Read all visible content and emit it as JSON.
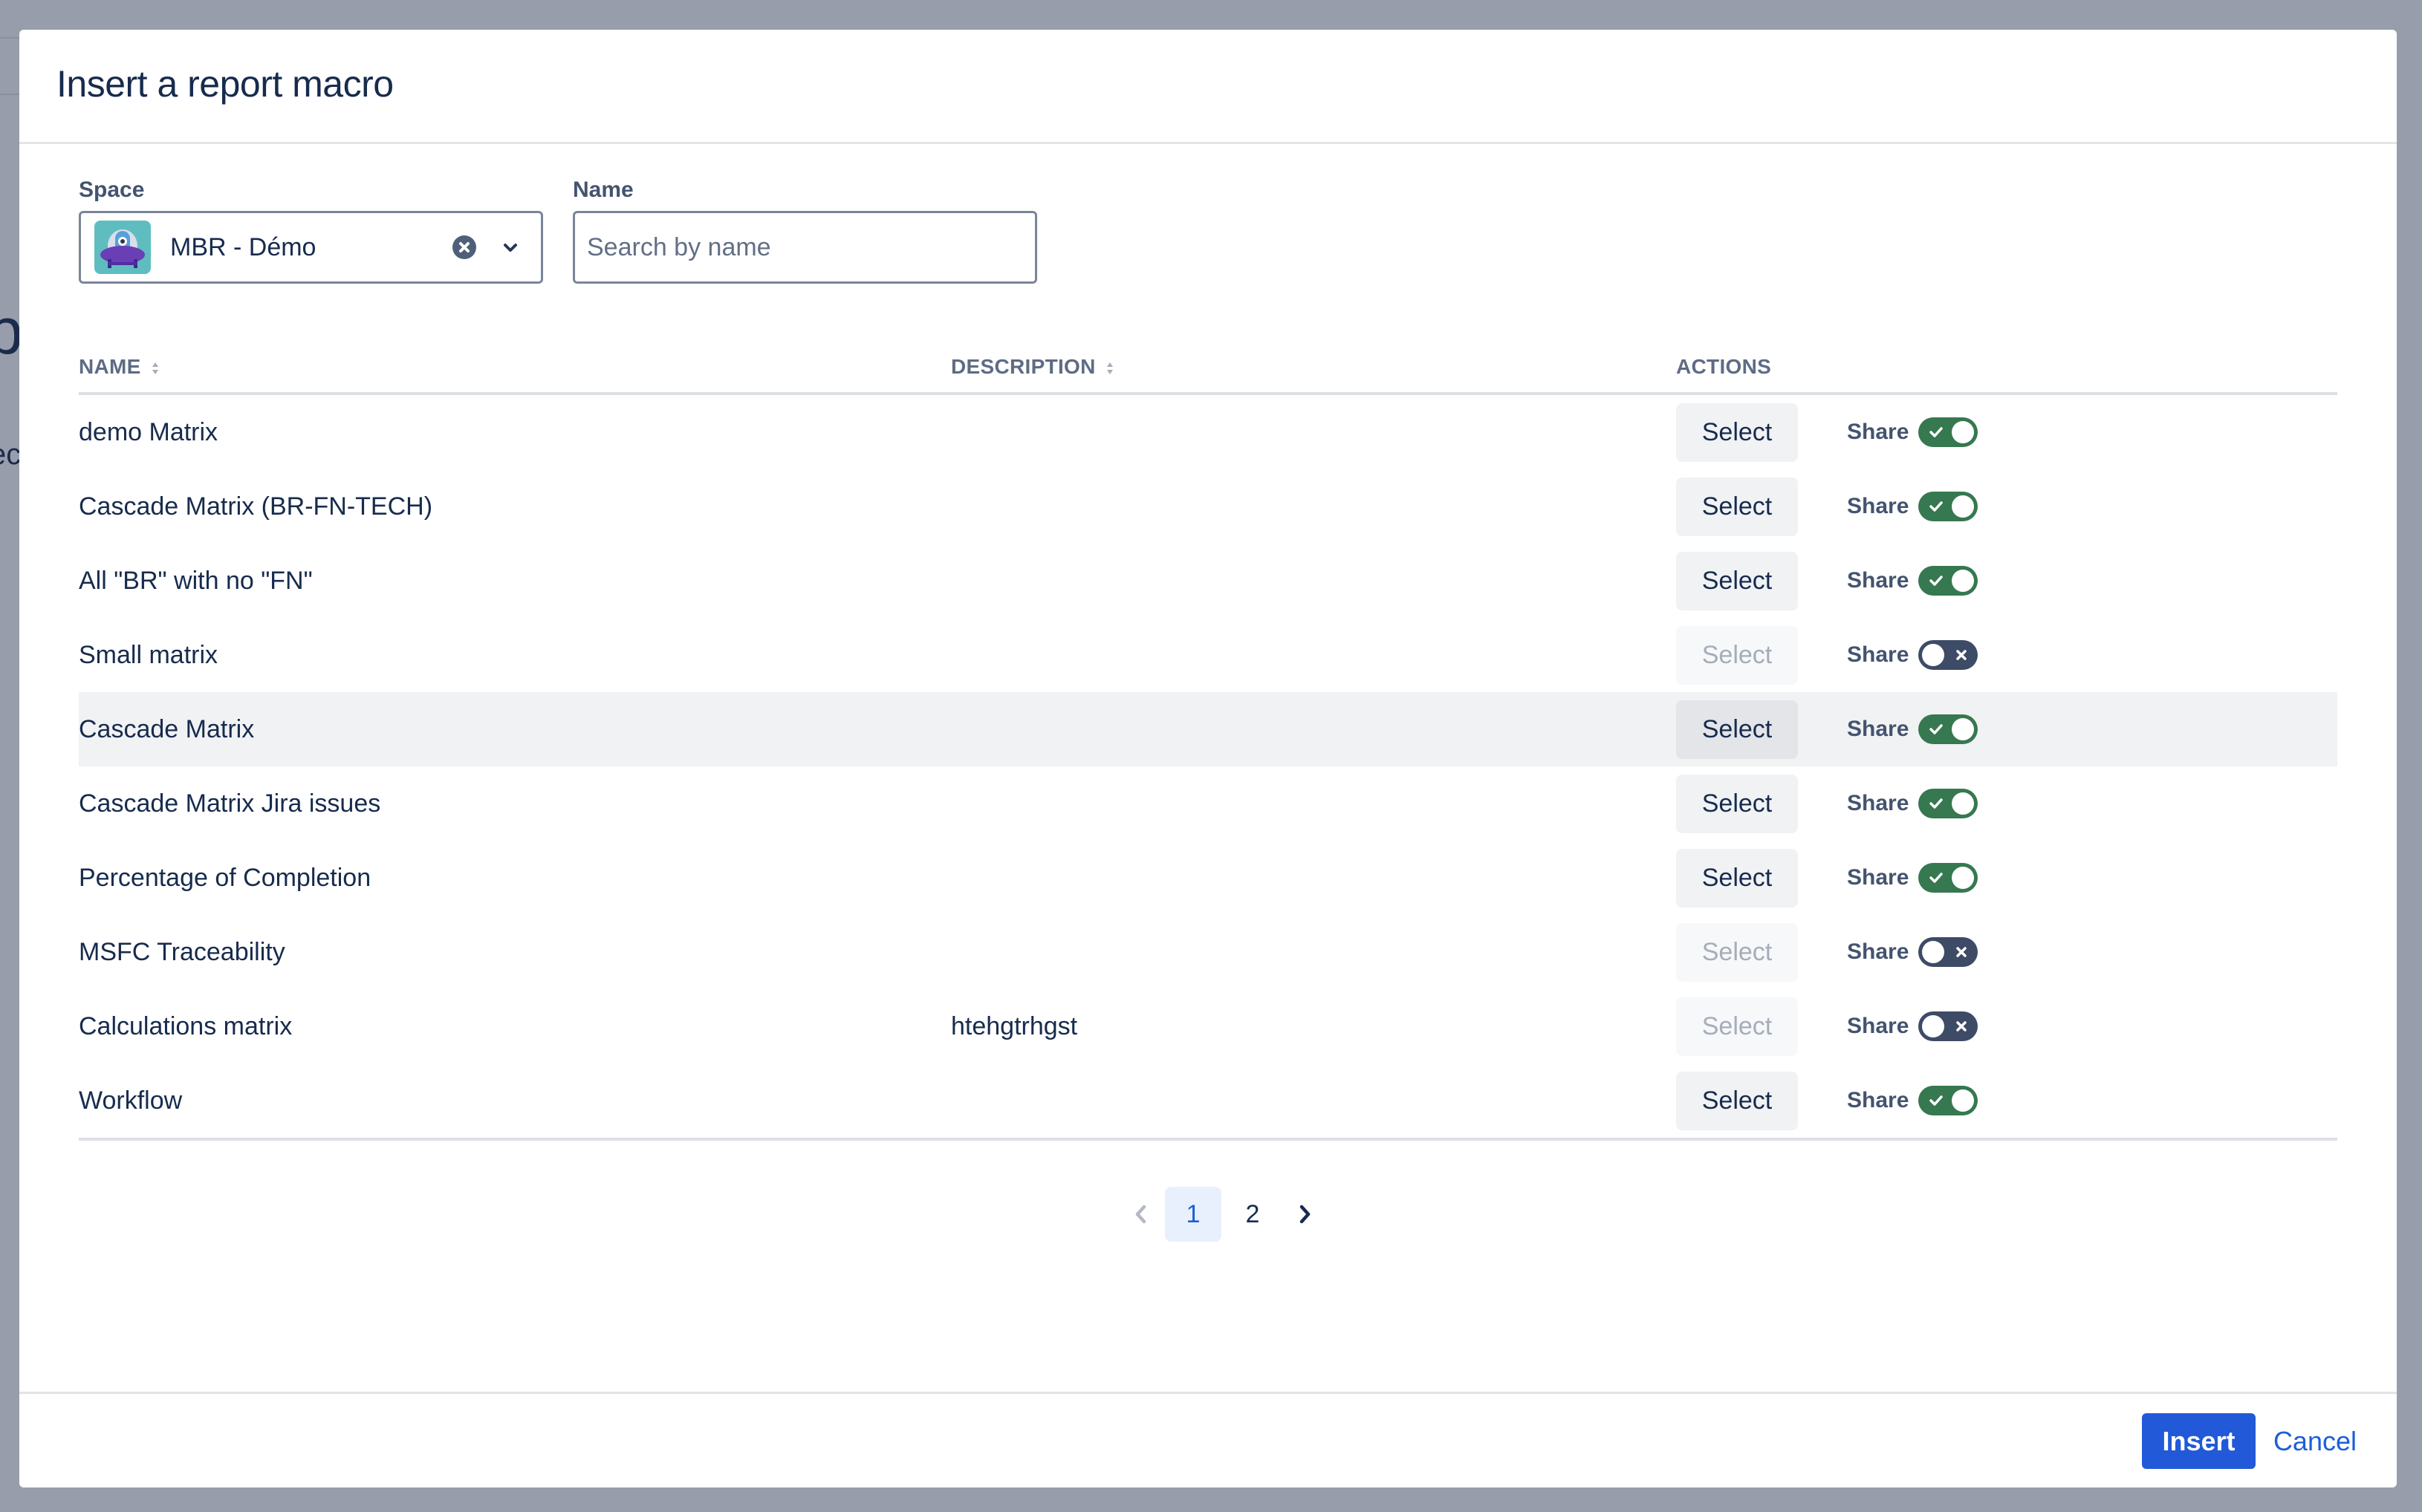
{
  "background": {
    "fragment_large": "p",
    "fragment_small": "ec"
  },
  "dialog": {
    "title": "Insert a report macro",
    "filters": {
      "space_label": "Space",
      "space_value": "MBR - Démo",
      "space_avatar_icon": "ufo-avatar-icon",
      "name_label": "Name",
      "name_value": "",
      "name_placeholder": "Search by name"
    },
    "table": {
      "columns": [
        {
          "label": "NAME",
          "sortable": true
        },
        {
          "label": "DESCRIPTION",
          "sortable": true
        },
        {
          "label": "ACTIONS",
          "sortable": false
        }
      ],
      "select_label": "Select",
      "share_label": "Share",
      "rows": [
        {
          "name": "demo Matrix",
          "description": "",
          "select_enabled": true,
          "shared": true
        },
        {
          "name": "Cascade Matrix (BR-FN-TECH)",
          "description": "",
          "select_enabled": true,
          "shared": true
        },
        {
          "name": "All \"BR\" with no \"FN\"",
          "description": "",
          "select_enabled": true,
          "shared": true
        },
        {
          "name": "Small matrix",
          "description": "",
          "select_enabled": false,
          "shared": false
        },
        {
          "name": "Cascade Matrix",
          "description": "",
          "select_enabled": true,
          "shared": true,
          "hovered": true
        },
        {
          "name": "Cascade Matrix Jira issues",
          "description": "",
          "select_enabled": true,
          "shared": true
        },
        {
          "name": "Percentage of Completion",
          "description": "",
          "select_enabled": true,
          "shared": true
        },
        {
          "name": "MSFC Traceability",
          "description": "",
          "select_enabled": false,
          "shared": false
        },
        {
          "name": "Calculations matrix",
          "description": "htehgtrhgst",
          "select_enabled": false,
          "shared": false
        },
        {
          "name": "Workflow",
          "description": "",
          "select_enabled": true,
          "shared": true
        }
      ]
    },
    "pagination": {
      "pages": [
        "1",
        "2"
      ],
      "current": "1",
      "prev_enabled": false,
      "next_enabled": true
    },
    "footer": {
      "insert_label": "Insert",
      "cancel_label": "Cancel"
    },
    "colors": {
      "primary": "#2159d8",
      "toggle_on": "#36784f",
      "toggle_off": "#3d4b66"
    }
  }
}
